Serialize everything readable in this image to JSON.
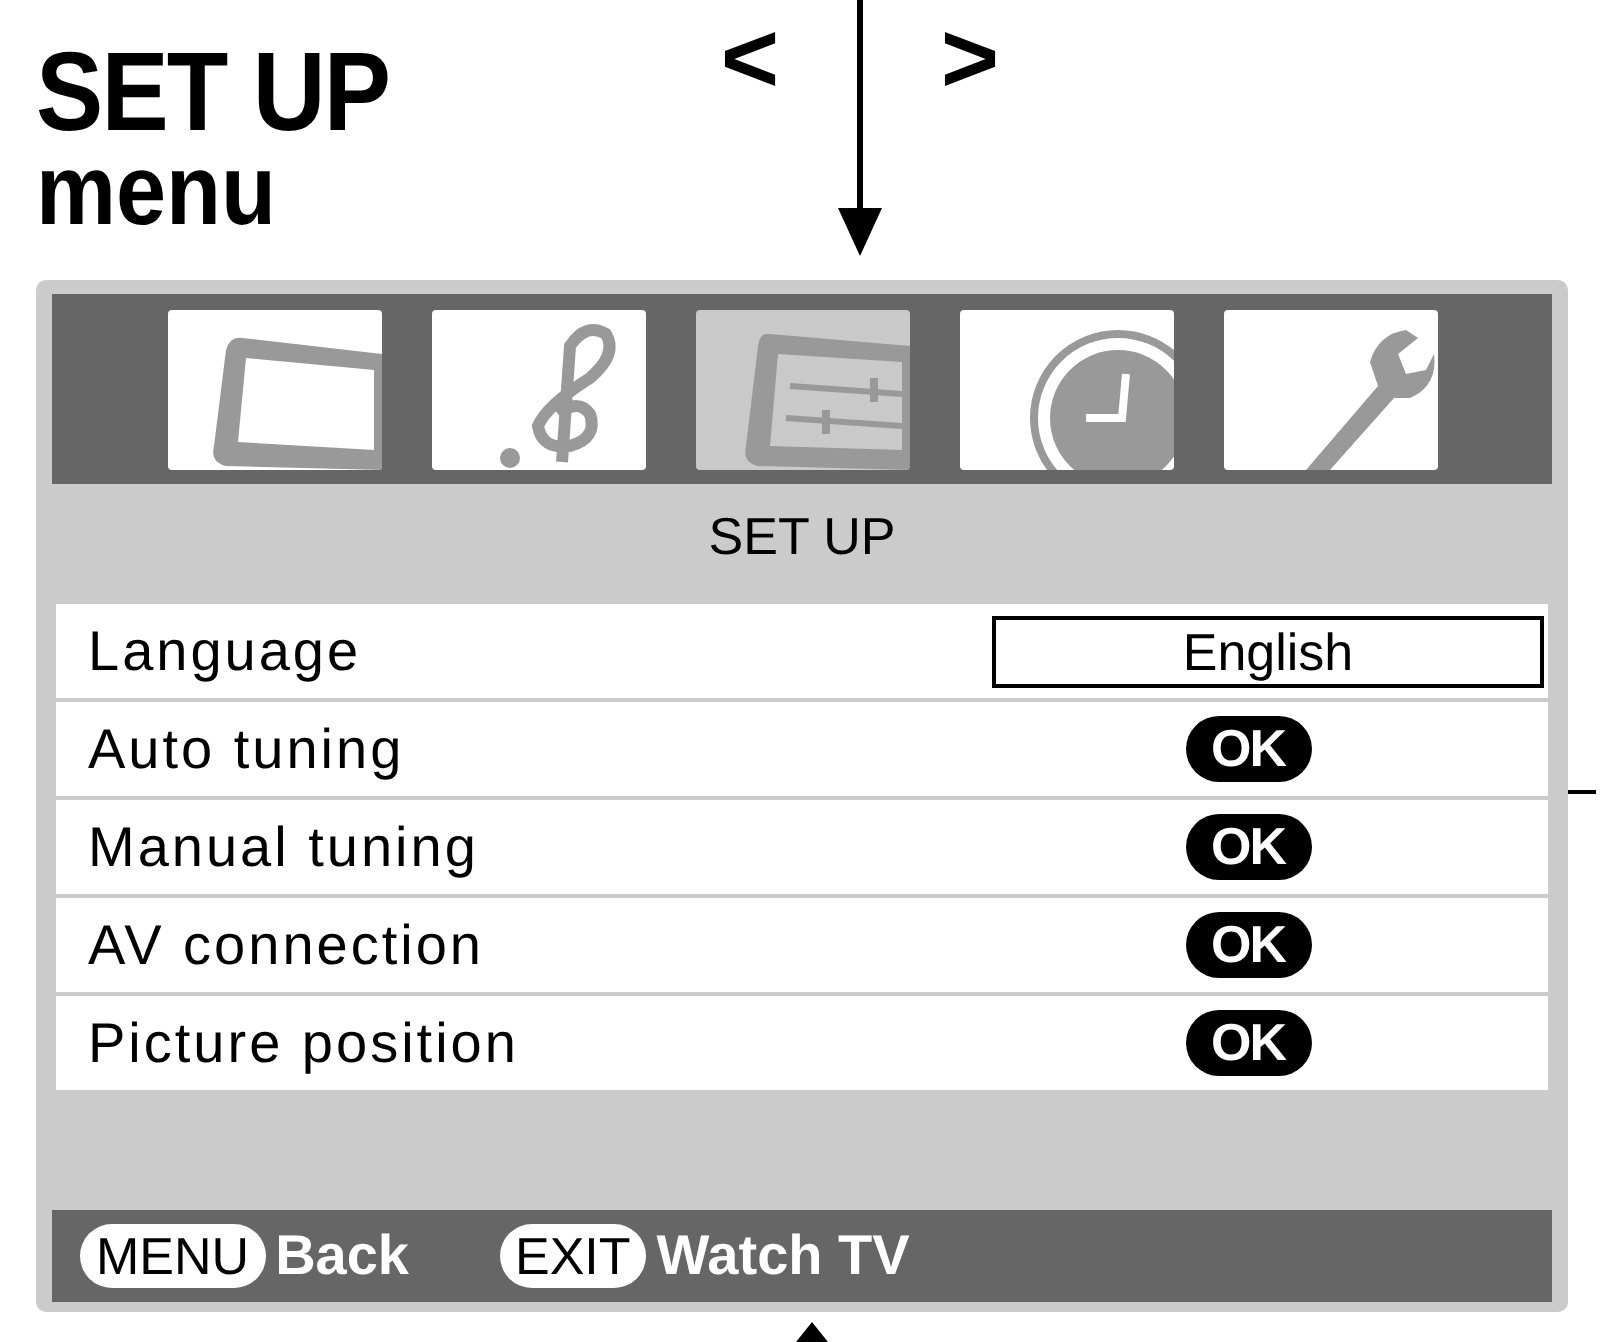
{
  "heading": {
    "title": "SET UP",
    "subtitle": "menu"
  },
  "nav": {
    "prev": "<",
    "next": ">"
  },
  "icons": [
    {
      "kind": "tv",
      "selected": false
    },
    {
      "kind": "music",
      "selected": false
    },
    {
      "kind": "setup",
      "selected": true
    },
    {
      "kind": "clock",
      "selected": false
    },
    {
      "kind": "wrench",
      "selected": false
    }
  ],
  "menu_title": "SET UP",
  "rows": [
    {
      "label": "Language",
      "kind": "value",
      "value": "English"
    },
    {
      "label": "Auto tuning",
      "kind": "ok",
      "value": "OK"
    },
    {
      "label": "Manual tuning",
      "kind": "ok",
      "value": "OK"
    },
    {
      "label": "AV connection",
      "kind": "ok",
      "value": "OK"
    },
    {
      "label": "Picture position",
      "kind": "ok",
      "value": "OK"
    }
  ],
  "footer": [
    {
      "key": "MENU",
      "action": "Back"
    },
    {
      "key": "EXIT",
      "action": "Watch TV"
    }
  ]
}
